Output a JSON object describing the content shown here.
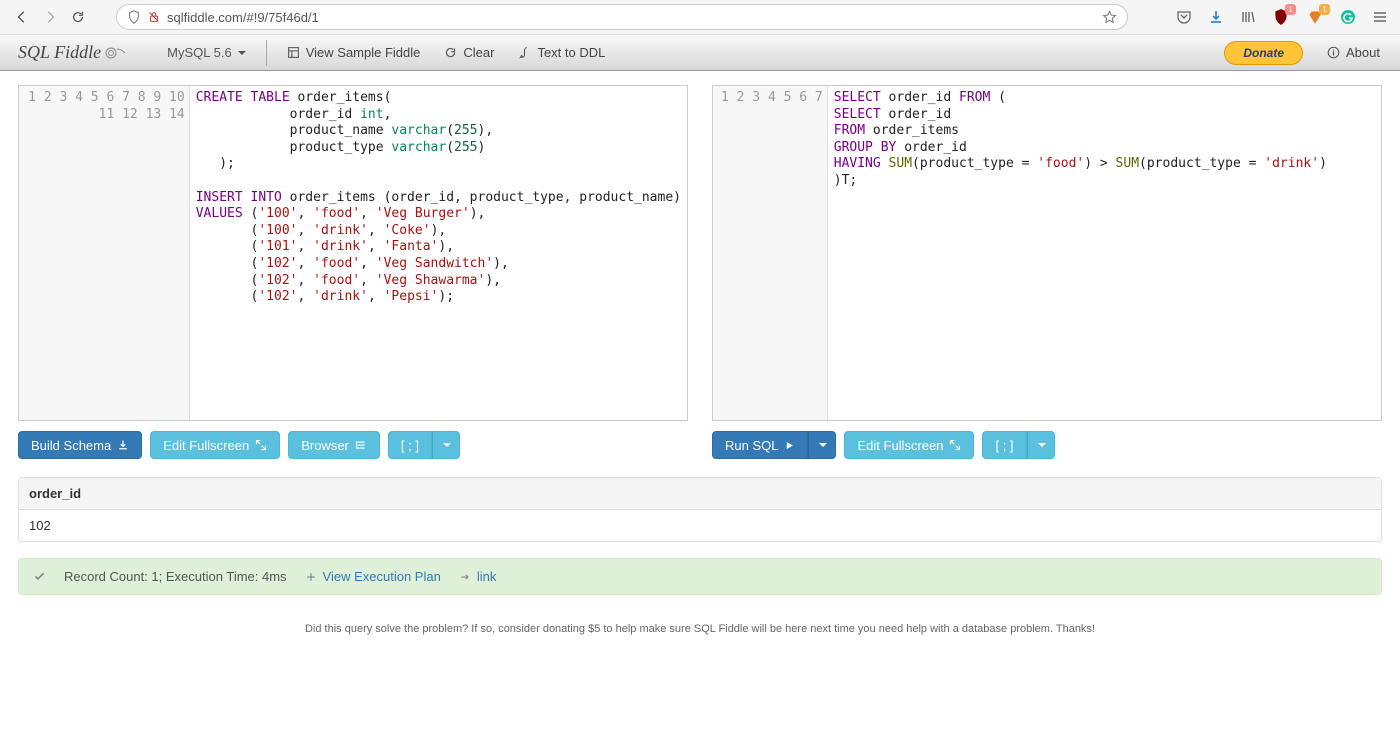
{
  "browser": {
    "url": "sqlfiddle.com/#!9/75f46d/1",
    "badge1": "1",
    "badge2": "1"
  },
  "app": {
    "logo_text": "SQL Fiddle",
    "db_label": "MySQL 5.6",
    "btn_sample": "View Sample Fiddle",
    "btn_clear": "Clear",
    "btn_text_to_ddl": "Text to DDL",
    "btn_donate": "Donate",
    "btn_about": "About"
  },
  "schema_editor": {
    "line_count": 14,
    "code_html": "<span class='kw'>CREATE</span> <span class='kw'>TABLE</span> order_items(\n            order_id <span class='type'>int</span>,\n            product_name <span class='type'>varchar</span>(<span class='num'>255</span>),\n            product_type <span class='type'>varchar</span>(<span class='num'>255</span>)\n   );\n\n<span class='kw'>INSERT</span> <span class='kw'>INTO</span> order_items (order_id, product_type, product_name)\n<span class='kw'>VALUES</span> (<span class='str'>'100'</span>, <span class='str'>'food'</span>, <span class='str'>'Veg Burger'</span>),\n       (<span class='str'>'100'</span>, <span class='str'>'drink'</span>, <span class='str'>'Coke'</span>),\n       (<span class='str'>'101'</span>, <span class='str'>'drink'</span>, <span class='str'>'Fanta'</span>),\n       (<span class='str'>'102'</span>, <span class='str'>'food'</span>, <span class='str'>'Veg Sandwitch'</span>),\n       (<span class='str'>'102'</span>, <span class='str'>'food'</span>, <span class='str'>'Veg Shawarma'</span>),\n       (<span class='str'>'102'</span>, <span class='str'>'drink'</span>, <span class='str'>'Pepsi'</span>);\n"
  },
  "query_editor": {
    "line_count": 7,
    "code_html": "<span class='kw'>SELECT</span> order_id <span class='kw'>FROM</span> (\n<span class='kw'>SELECT</span> order_id\n<span class='kw'>FROM</span> order_items\n<span class='kw'>GROUP</span> <span class='kw'>BY</span> order_id\n<span class='kw'>HAVING</span> <span class='fn'>SUM</span>(product_type <span class='op'>=</span> <span class='str'>'food'</span>) <span class='op'>&gt;</span> <span class='fn'>SUM</span>(product_type <span class='op'>=</span> <span class='str'>'drink'</span>)\n)T;\n"
  },
  "buttons": {
    "build_schema": "Build Schema",
    "edit_fullscreen": "Edit Fullscreen",
    "browser": "Browser",
    "terminator": "[ ; ]",
    "run_sql": "Run SQL"
  },
  "results": {
    "columns": [
      "order_id"
    ],
    "rows": [
      [
        "102"
      ]
    ]
  },
  "status": {
    "summary": "Record Count: 1; Execution Time: 4ms",
    "link1": "View Execution Plan",
    "link2": "link"
  },
  "footer": "Did this query solve the problem? If so, consider donating $5 to help make sure SQL Fiddle will be here next time you need help with a database problem. Thanks!"
}
